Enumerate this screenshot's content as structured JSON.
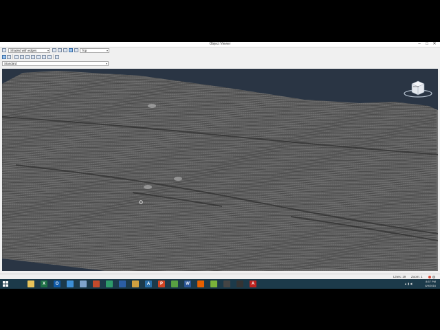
{
  "window": {
    "title": "Object Viewer",
    "controls": {
      "minimize": "–",
      "maximize": "□",
      "close": "✕"
    }
  },
  "toolbar": {
    "visual_style": "Shaded with edges",
    "view": "Top",
    "style_list": "Standard"
  },
  "viewcube": {
    "face_label": "FRONT"
  },
  "status": {
    "lines": "Lines: 19",
    "zoom": "Zoom: 1"
  },
  "clock": {
    "time": "8:57 PM",
    "date": "8/9/2016"
  },
  "taskbar": {
    "apps": [
      {
        "name": "file-explorer",
        "color": "#e8c35a",
        "glyph": ""
      },
      {
        "name": "excel",
        "color": "#1e7145",
        "glyph": "X"
      },
      {
        "name": "outlook",
        "color": "#0f5aa8",
        "glyph": "O"
      },
      {
        "name": "photos",
        "color": "#3d8fd6",
        "glyph": ""
      },
      {
        "name": "document",
        "color": "#7fa4cc",
        "glyph": ""
      },
      {
        "name": "tool-app",
        "color": "#c44a2b",
        "glyph": ""
      },
      {
        "name": "network-app",
        "color": "#2e9b6a",
        "glyph": ""
      },
      {
        "name": "app-blue",
        "color": "#2b5ea5",
        "glyph": ""
      },
      {
        "name": "app-gear",
        "color": "#cfa040",
        "glyph": ""
      },
      {
        "name": "autocad-a",
        "color": "#2a6fa8",
        "glyph": "A"
      },
      {
        "name": "powerpoint",
        "color": "#d04423",
        "glyph": "P"
      },
      {
        "name": "app-green",
        "color": "#58a042",
        "glyph": ""
      },
      {
        "name": "word",
        "color": "#2b579a",
        "glyph": "W"
      },
      {
        "name": "firefox",
        "color": "#e66000",
        "glyph": ""
      },
      {
        "name": "app-lime",
        "color": "#7ab33a",
        "glyph": ""
      },
      {
        "name": "app-dark",
        "color": "#444444",
        "glyph": ""
      },
      {
        "name": "app-clock",
        "color": "#333333",
        "glyph": ""
      },
      {
        "name": "autocad-red",
        "color": "#c0231f",
        "glyph": "A"
      }
    ]
  },
  "colors": {
    "viewport_bg": "#2a3544",
    "mesh": "#8c8c8c",
    "taskbar": "#1c3a4a"
  }
}
